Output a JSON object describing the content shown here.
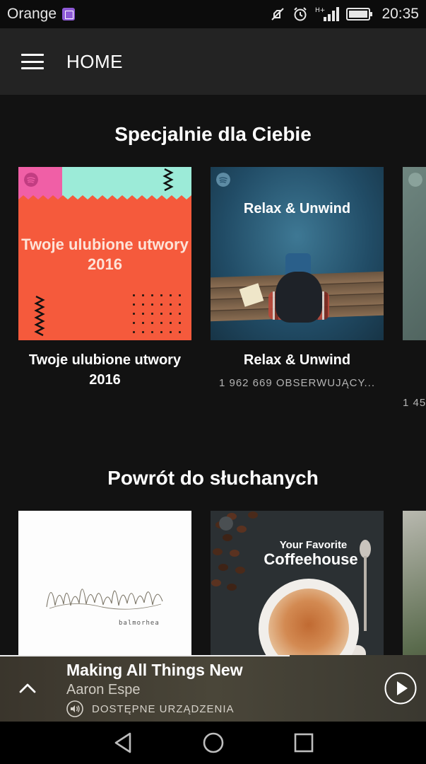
{
  "status_bar": {
    "carrier": "Orange",
    "time": "20:35",
    "network": "H+"
  },
  "app_bar": {
    "title": "HOME"
  },
  "sections": [
    {
      "title": "Specjalnie dla Ciebie",
      "cards": [
        {
          "art_text": "Twoje ulubione utwory 2016",
          "name": "Twoje ulubione utwory 2016",
          "subtitle": ""
        },
        {
          "art_text": "Relax & Unwind",
          "name": "Relax & Unwind",
          "subtitle": "1 962 669 OBSERWUJĄCY..."
        },
        {
          "subtitle": "1 45"
        }
      ]
    },
    {
      "title": "Powrót do słuchanych",
      "cards": [
        {
          "art_text": "balmorhea"
        },
        {
          "art_text_small": "Your Favorite",
          "art_text": "Coffeehouse"
        },
        {}
      ]
    }
  ],
  "player": {
    "track": "Making All Things New",
    "artist": "Aaron Espe",
    "devices_label": "DOSTĘPNE URZĄDZENIA",
    "progress": 0.68
  },
  "colors": {
    "background": "#121212",
    "app_bar": "#232323",
    "spotify_green": "#1db954",
    "subtitle_gray": "#b3b3b3"
  },
  "icons": {
    "menu": "hamburger-icon",
    "expand": "chevron-up-icon",
    "devices": "speaker-icon",
    "play": "play-icon",
    "nav": [
      "back-icon",
      "home-icon",
      "recents-icon"
    ]
  }
}
